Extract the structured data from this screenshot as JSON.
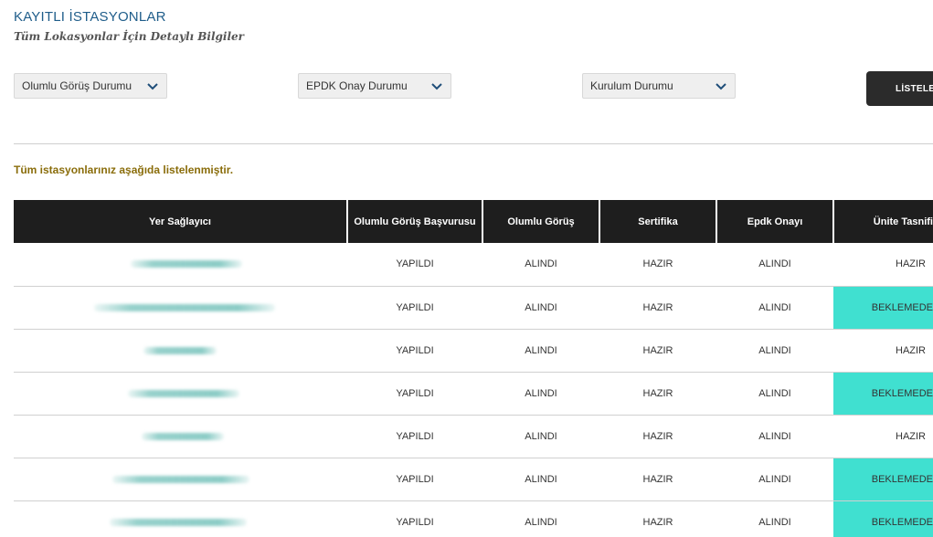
{
  "header": {
    "title": "KAYITLI İSTASYONLAR",
    "subtitle": "Tüm Lokasyonlar İçin Detaylı Bilgiler"
  },
  "filters": [
    {
      "selected": "Olumlu Görüş Durumu"
    },
    {
      "selected": "EPDK Onay Durumu"
    },
    {
      "selected": "Kurulum Durumu"
    }
  ],
  "list_button": "LİSTELE",
  "notice": "Tüm istasyonlarınız aşağıda listelenmiştir.",
  "table": {
    "columns": [
      "Yer Sağlayıcı",
      "Olumlu Görüş Başvurusu",
      "Olumlu Görüş",
      "Sertifika",
      "Epdk Onayı",
      "Ünite Tasnifi"
    ],
    "rows": [
      {
        "application": "YAPILDI",
        "opinion": "ALINDI",
        "certificate": "HAZIR",
        "epdk": "ALINDI",
        "unit": "HAZIR"
      },
      {
        "application": "YAPILDI",
        "opinion": "ALINDI",
        "certificate": "HAZIR",
        "epdk": "ALINDI",
        "unit": "BEKLEMEDE"
      },
      {
        "application": "YAPILDI",
        "opinion": "ALINDI",
        "certificate": "HAZIR",
        "epdk": "ALINDI",
        "unit": "HAZIR"
      },
      {
        "application": "YAPILDI",
        "opinion": "ALINDI",
        "certificate": "HAZIR",
        "epdk": "ALINDI",
        "unit": "BEKLEMEDE"
      },
      {
        "application": "YAPILDI",
        "opinion": "ALINDI",
        "certificate": "HAZIR",
        "epdk": "ALINDI",
        "unit": "HAZIR"
      },
      {
        "application": "YAPILDI",
        "opinion": "ALINDI",
        "certificate": "HAZIR",
        "epdk": "ALINDI",
        "unit": "BEKLEMEDE"
      },
      {
        "application": "YAPILDI",
        "opinion": "ALINDI",
        "certificate": "HAZIR",
        "epdk": "ALINDI",
        "unit": "BEKLEMEDE"
      }
    ]
  },
  "colors": {
    "title": "#1f5d8a",
    "notice": "#8a6d0b",
    "header_bg": "#1e1e1e",
    "pending_bg": "#40e0d0",
    "button_bg": "#2b2b2b"
  },
  "icons": {
    "dropdown": "chevron-down-icon"
  }
}
